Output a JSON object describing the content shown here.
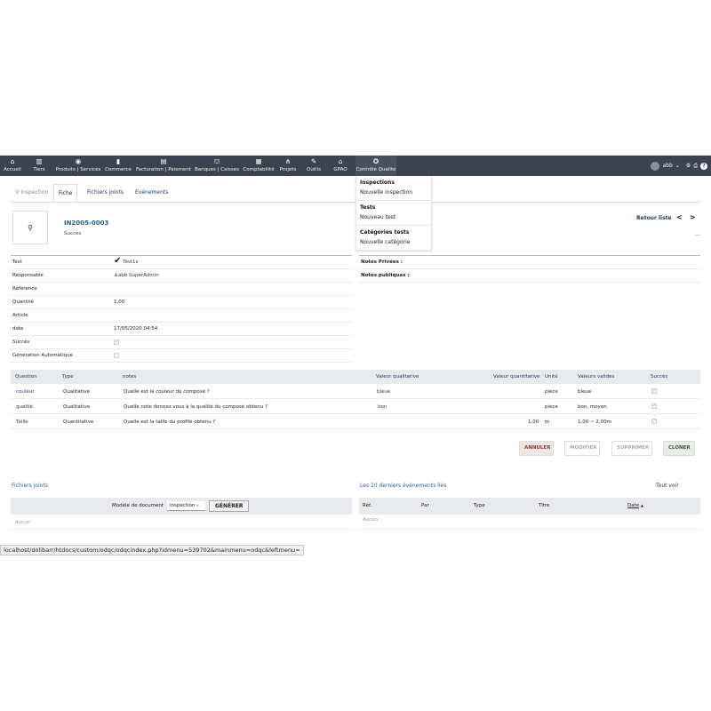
{
  "topmenu": {
    "items": [
      {
        "label": "Accueil",
        "icon": "home-icon",
        "glyph": "⌂"
      },
      {
        "label": "Tiers",
        "icon": "building-icon",
        "glyph": "▥"
      },
      {
        "label": "Produits | Services",
        "icon": "cube-icon",
        "glyph": "◉"
      },
      {
        "label": "Commerce",
        "icon": "briefcase-icon",
        "glyph": "▮"
      },
      {
        "label": "Facturation | Paiement",
        "icon": "invoice-icon",
        "glyph": "▤"
      },
      {
        "label": "Banques | Caisses",
        "icon": "bank-icon",
        "glyph": "⛫"
      },
      {
        "label": "Comptabilité",
        "icon": "calculator-icon",
        "glyph": "▦"
      },
      {
        "label": "Projets",
        "icon": "sitemap-icon",
        "glyph": "⋔"
      },
      {
        "label": "Outils",
        "icon": "wrench-icon",
        "glyph": "✎"
      },
      {
        "label": "GPAO",
        "icon": "factory-icon",
        "glyph": "⌂"
      },
      {
        "label": "Contrôle Qualité",
        "icon": "medal-icon",
        "glyph": "✪"
      }
    ],
    "user": {
      "name": "abb",
      "caret": "⌄"
    },
    "right_icons": {
      "settings": "⚙",
      "print": "⎙",
      "help": "?"
    }
  },
  "dropdown": {
    "groups": [
      {
        "title": "Inspections",
        "link": "Nouvelle inspection"
      },
      {
        "title": "Tests",
        "link": "Nouveau test"
      },
      {
        "title": "Catégories tests",
        "link": "Nouvelle catégorie"
      }
    ]
  },
  "tabs": {
    "inspection": "Inspection",
    "fiche": "Fiche",
    "fichiers": "Fichiers joints",
    "evenements": "Evénements"
  },
  "header": {
    "ref": "IN2005-0003",
    "status": "Succès",
    "return_list": "Retour liste",
    "prev": "<",
    "next": ">"
  },
  "fields": {
    "test_label": "Test",
    "test_value": "Test1x",
    "responsable_label": "Responsable",
    "responsable_value": "abb SuperAdmin",
    "reference_label": "Référence",
    "quantite_label": "Quantité",
    "quantite_value": "1,00",
    "article_label": "Article",
    "date_label": "date",
    "date_value": "17/05/2020 04:54",
    "succes_label": "Succès",
    "generation_label": "Génération Automatique"
  },
  "notes": {
    "private": "Notes Privées :",
    "public": "Notes publiques :"
  },
  "table": {
    "headers": {
      "question": "Question",
      "type": "Type",
      "notes": "notes",
      "valeur_qual": "Valeur qualitative",
      "valeur_quant": "Valeur quantitative",
      "unite": "Unité",
      "valeurs_valides": "Valeurs valides",
      "succes": "Succès"
    },
    "rows": [
      {
        "question": "couleur",
        "type": "Qualitative",
        "notes": "Quelle est la couleur du composé ?",
        "valeur_qual": "bleue",
        "valeur_quant": "",
        "unite": "piece",
        "valeurs_valides": "bleue"
      },
      {
        "question": "qualité",
        "type": "Qualitative",
        "notes": "Quelle note donnez vous à la qualité du composé obtenu ?",
        "valeur_qual": "bon",
        "valeur_quant": "",
        "unite": "piece",
        "valeurs_valides": "bon, moyen"
      },
      {
        "question": "Taille",
        "type": "Quantitative",
        "notes": "Quelle est la taille du profilé obtenu ?",
        "valeur_qual": "",
        "valeur_quant": "1,00",
        "unite": "m",
        "valeurs_valides": "1,00 ~ 2,00m"
      }
    ]
  },
  "actions": {
    "annuler": "ANNULER",
    "modifier": "MODIFIER",
    "supprimer": "SUPPRIMER",
    "cloner": "CLONER"
  },
  "files": {
    "title": "Fichiers joints",
    "model_label": "Modèle de document",
    "model_value": "inspection",
    "generate": "GÉNÉRER",
    "empty": "Aucun"
  },
  "events": {
    "title": "Les 10 derniers événements liés",
    "see_all": "Tout voir",
    "col_ref": "Réf.",
    "col_par": "Par",
    "col_type": "Type",
    "col_titre": "Titre",
    "col_date": "Date",
    "sort_indicator": "▲",
    "empty": "Aucun"
  },
  "statusbar": {
    "url": "localhost/dolibarr/htdocs/custom/odqc/odqcindex.php?idmenu=539702&mainmenu=odqc&leftmenu="
  }
}
